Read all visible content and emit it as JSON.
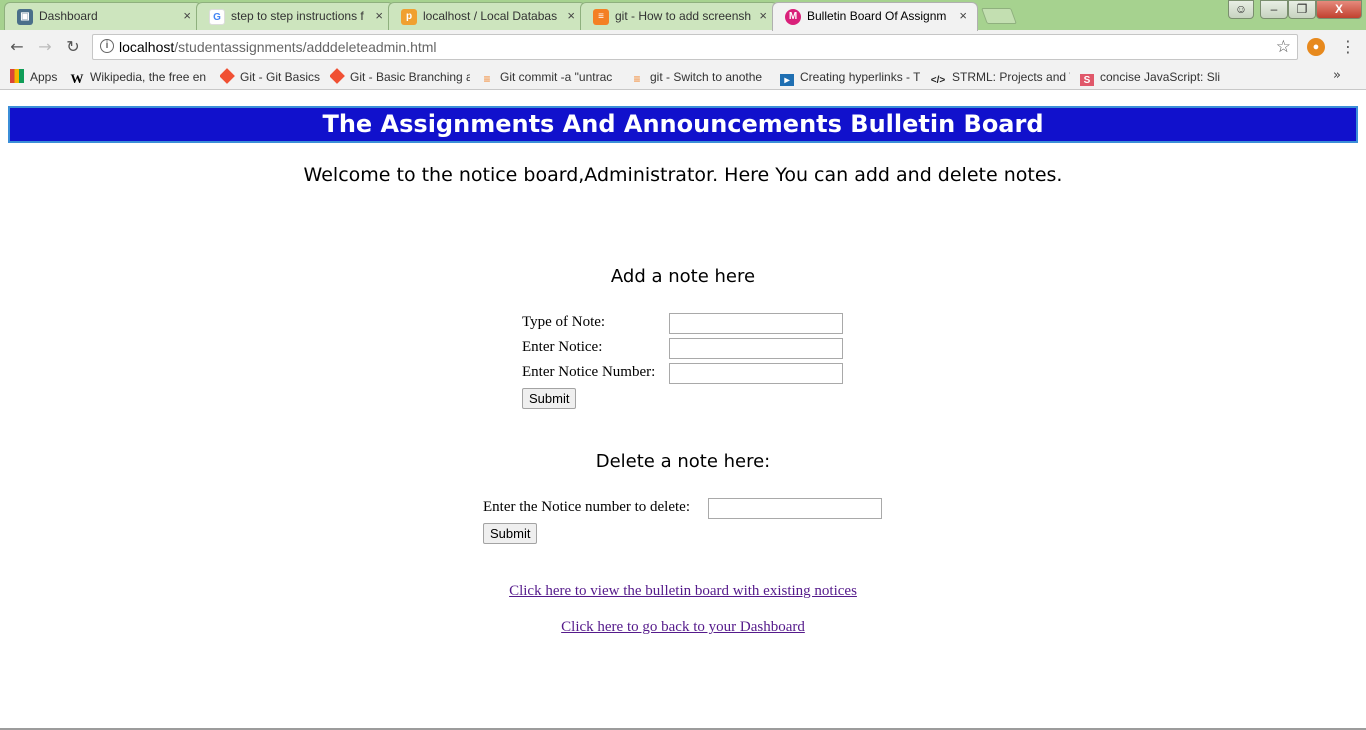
{
  "browser": {
    "tabs": [
      {
        "title": "Dashboard",
        "icon": "dashboard-icon",
        "active": false
      },
      {
        "title": "step to step instructions f",
        "icon": "google-icon",
        "active": false
      },
      {
        "title": "localhost / Local Databas",
        "icon": "phpmyadmin-icon",
        "active": false
      },
      {
        "title": "git - How to add screensh",
        "icon": "stackoverflow-icon",
        "active": false
      },
      {
        "title": "Bulletin Board Of Assignm",
        "icon": "bulletin-icon",
        "active": true
      }
    ],
    "close_glyph": "×",
    "window_controls": {
      "minimize": "–",
      "maximize": "❐",
      "close": "X"
    },
    "url": {
      "host": "localhost",
      "path": "/studentassignments/adddeleteadmin.html"
    },
    "bookmarks": [
      {
        "label": "Apps",
        "icon": "apps-icon"
      },
      {
        "label": "Wikipedia, the free en",
        "icon": "wikipedia-icon"
      },
      {
        "label": "Git - Git Basics",
        "icon": "git-icon"
      },
      {
        "label": "Git - Basic Branching a",
        "icon": "git-icon"
      },
      {
        "label": "Git commit -a \"untrac",
        "icon": "stackoverflow-icon"
      },
      {
        "label": "git - Switch to anothe",
        "icon": "stackoverflow-icon"
      },
      {
        "label": "Creating hyperlinks - T",
        "icon": "hyperlink-icon"
      },
      {
        "label": "STRML: Projects and W",
        "icon": "code-icon"
      },
      {
        "label": "concise JavaScript: Sli",
        "icon": "slides-icon"
      }
    ],
    "bookmarks_more": "»"
  },
  "page": {
    "banner_title": "The Assignments And Announcements Bulletin Board",
    "welcome": "Welcome to the notice board,Administrator. Here You can add and delete notes.",
    "add_section": {
      "title": "Add a note here",
      "labels": {
        "type": "Type of Note:",
        "notice": "Enter Notice:",
        "number": "Enter Notice Number:"
      },
      "values": {
        "type": "",
        "notice": "",
        "number": ""
      },
      "submit": "Submit"
    },
    "delete_section": {
      "title": "Delete a note here:",
      "label": "Enter the Notice number to delete:",
      "value": "",
      "submit": "Submit"
    },
    "links": {
      "view_board": "Click here to view the bulletin board with existing notices",
      "dashboard": "Click here to go back to your Dashboard"
    }
  }
}
